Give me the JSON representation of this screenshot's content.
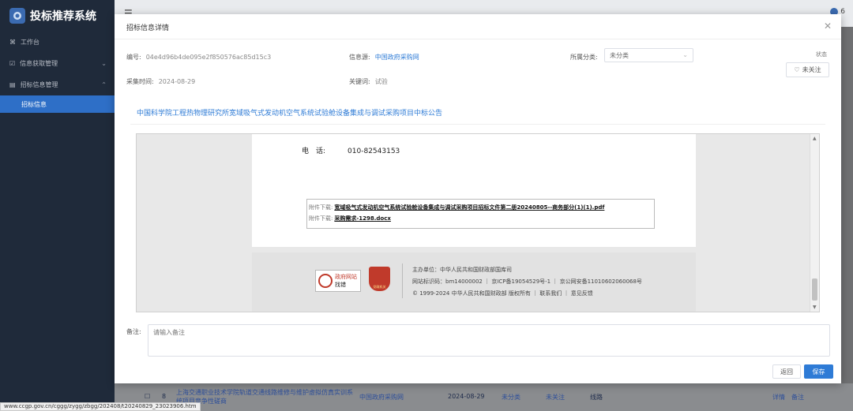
{
  "app": {
    "title": "投标推荐系统"
  },
  "sidebar": {
    "items": [
      {
        "label": "工作台"
      },
      {
        "label": "信息获取管理"
      },
      {
        "label": "招标信息管理"
      }
    ],
    "active_sub": "招标信息"
  },
  "modal": {
    "title": "招标信息详情",
    "fields": {
      "id_label": "编号:",
      "id_value": "04e4d96b4de095e2f850576ac85d15c3",
      "source_label": "信息源:",
      "source_value": "中国政府采购网",
      "category_label": "所属分类:",
      "category_value": "未分类",
      "time_label": "采集时间:",
      "time_value": "2024-08-29",
      "keyword_label": "关键词:",
      "keyword_value": "试验"
    },
    "status_label": "状态",
    "follow_label": "未关注",
    "notice_title": "中国科学院工程热物理研究所宽域吸气式发动机空气系统试验舱设备集成与调试采购项目中标公告",
    "embedded": {
      "phone_label": "电　话:",
      "phone_value": "010-82543153",
      "attachments": [
        {
          "label": "附件下载:",
          "file": "宽域吸气式发动机空气系统试验舱设备集成与调试采购项目招标文件第二册20240805--商务部分(1)(1).pdf"
        },
        {
          "label": "附件下载:",
          "file": "采购需求-1298.docx"
        }
      ],
      "gov_logo_line1": "政府网站",
      "gov_logo_line2": "找错",
      "badge_text": "党政机关",
      "footer_lines": [
        "主办单位：中华人民共和国财政部国库司",
        "网站标识码：bm14000002 ｜ 京ICP备19054529号-1 ｜ 京公网安备11010602060068号",
        "© 1999-2024 中华人民共和国财政部 版权所有 ｜ 联系我们 ｜ 意见反馈"
      ]
    },
    "remark_label": "备注:",
    "remark_placeholder": "请输入备注",
    "back_label": "返回",
    "save_label": "保存"
  },
  "background_row": {
    "index": "8",
    "title_line1": "上海交通职业技术学院轨道交通线路维修与维护虚拟仿真实训系",
    "title_line2": "统项目竞争性磋商",
    "source": "中国政府采购网",
    "date": "2024-08-29",
    "category": "未分类",
    "follow": "未关注",
    "keyword": "线路",
    "action_detail": "详情",
    "action_remark": "备注"
  },
  "top_user_suffix": "6",
  "status_url": "www.ccgp.gov.cn/cggg/zygg/zbgg/202408/t20240829_23023906.htm",
  "colors": {
    "sidebar": "#1f2a3a",
    "accent": "#2e7bd6",
    "active_nav": "#2e6fc7"
  }
}
